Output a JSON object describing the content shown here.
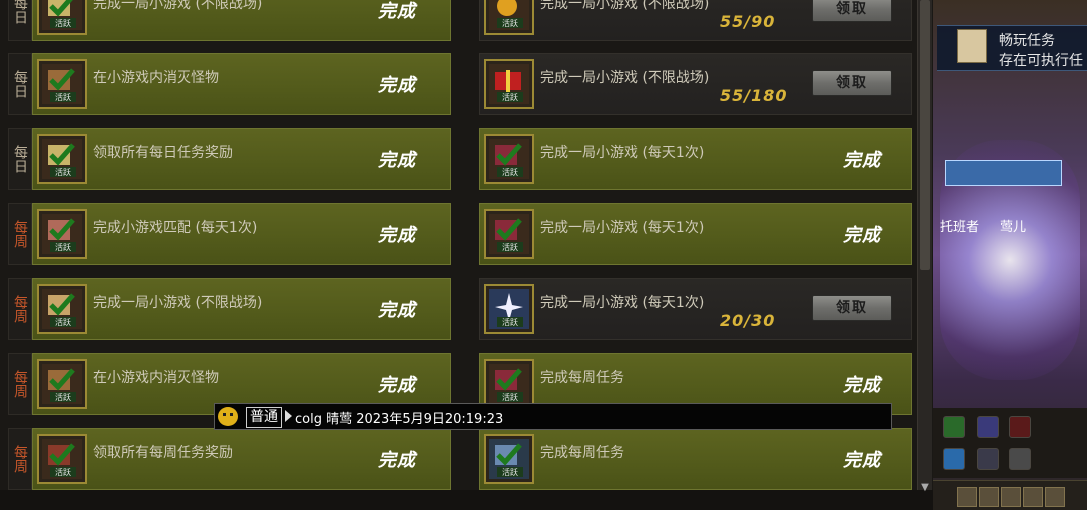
{
  "labels": {
    "daily": "每日",
    "weekly": "每周",
    "complete": "完成",
    "claim": "领取",
    "badge": "活跃"
  },
  "left_tasks": [
    {
      "period": "daily",
      "title": "完成一局小游戏 (不限战场)",
      "status": "完成"
    },
    {
      "period": "daily",
      "title": "在小游戏内消灭怪物",
      "status": "完成"
    },
    {
      "period": "daily",
      "title": "领取所有每日任务奖励",
      "status": "完成"
    },
    {
      "period": "weekly",
      "title": "完成小游戏匹配 (每天1次)",
      "status": "完成"
    },
    {
      "period": "weekly",
      "title": "完成一局小游戏 (不限战场)",
      "status": "完成"
    },
    {
      "period": "weekly",
      "title": "在小游戏内消灭怪物",
      "status": "完成"
    },
    {
      "period": "weekly",
      "title": "领取所有每周任务奖励",
      "status": "完成"
    }
  ],
  "right_tasks": [
    {
      "title": "完成一局小游戏 (不限战场)",
      "progress": "55/90",
      "button": "领取",
      "state": "claim"
    },
    {
      "title": "完成一局小游戏 (不限战场)",
      "progress": "55/180",
      "button": "领取",
      "state": "claim"
    },
    {
      "title": "完成一局小游戏 (每天1次)",
      "status": "完成",
      "state": "done"
    },
    {
      "title": "完成一局小游戏 (每天1次)",
      "status": "完成",
      "state": "done"
    },
    {
      "title": "完成一局小游戏 (每天1次)",
      "progress": "20/30",
      "button": "领取",
      "state": "claim"
    },
    {
      "title": "完成每周任务",
      "status": "完成",
      "state": "done"
    },
    {
      "title": "完成每周任务",
      "status": "完成",
      "state": "done"
    }
  ],
  "quest_panel": {
    "title": "畅玩任务",
    "subtitle": "存在可执行任"
  },
  "character": {
    "guild_label": "托班者",
    "name_label": "莺儿"
  },
  "chat": {
    "channel": "普通",
    "message": "colg 晴莺 2023年5月9日20:19:23"
  },
  "colors": {
    "done_bg": "#56601c",
    "claim_bg": "#262421",
    "progress": "#d9b43a",
    "weekly_tag": "#c4562a",
    "daily_tag": "#b9ad96"
  }
}
